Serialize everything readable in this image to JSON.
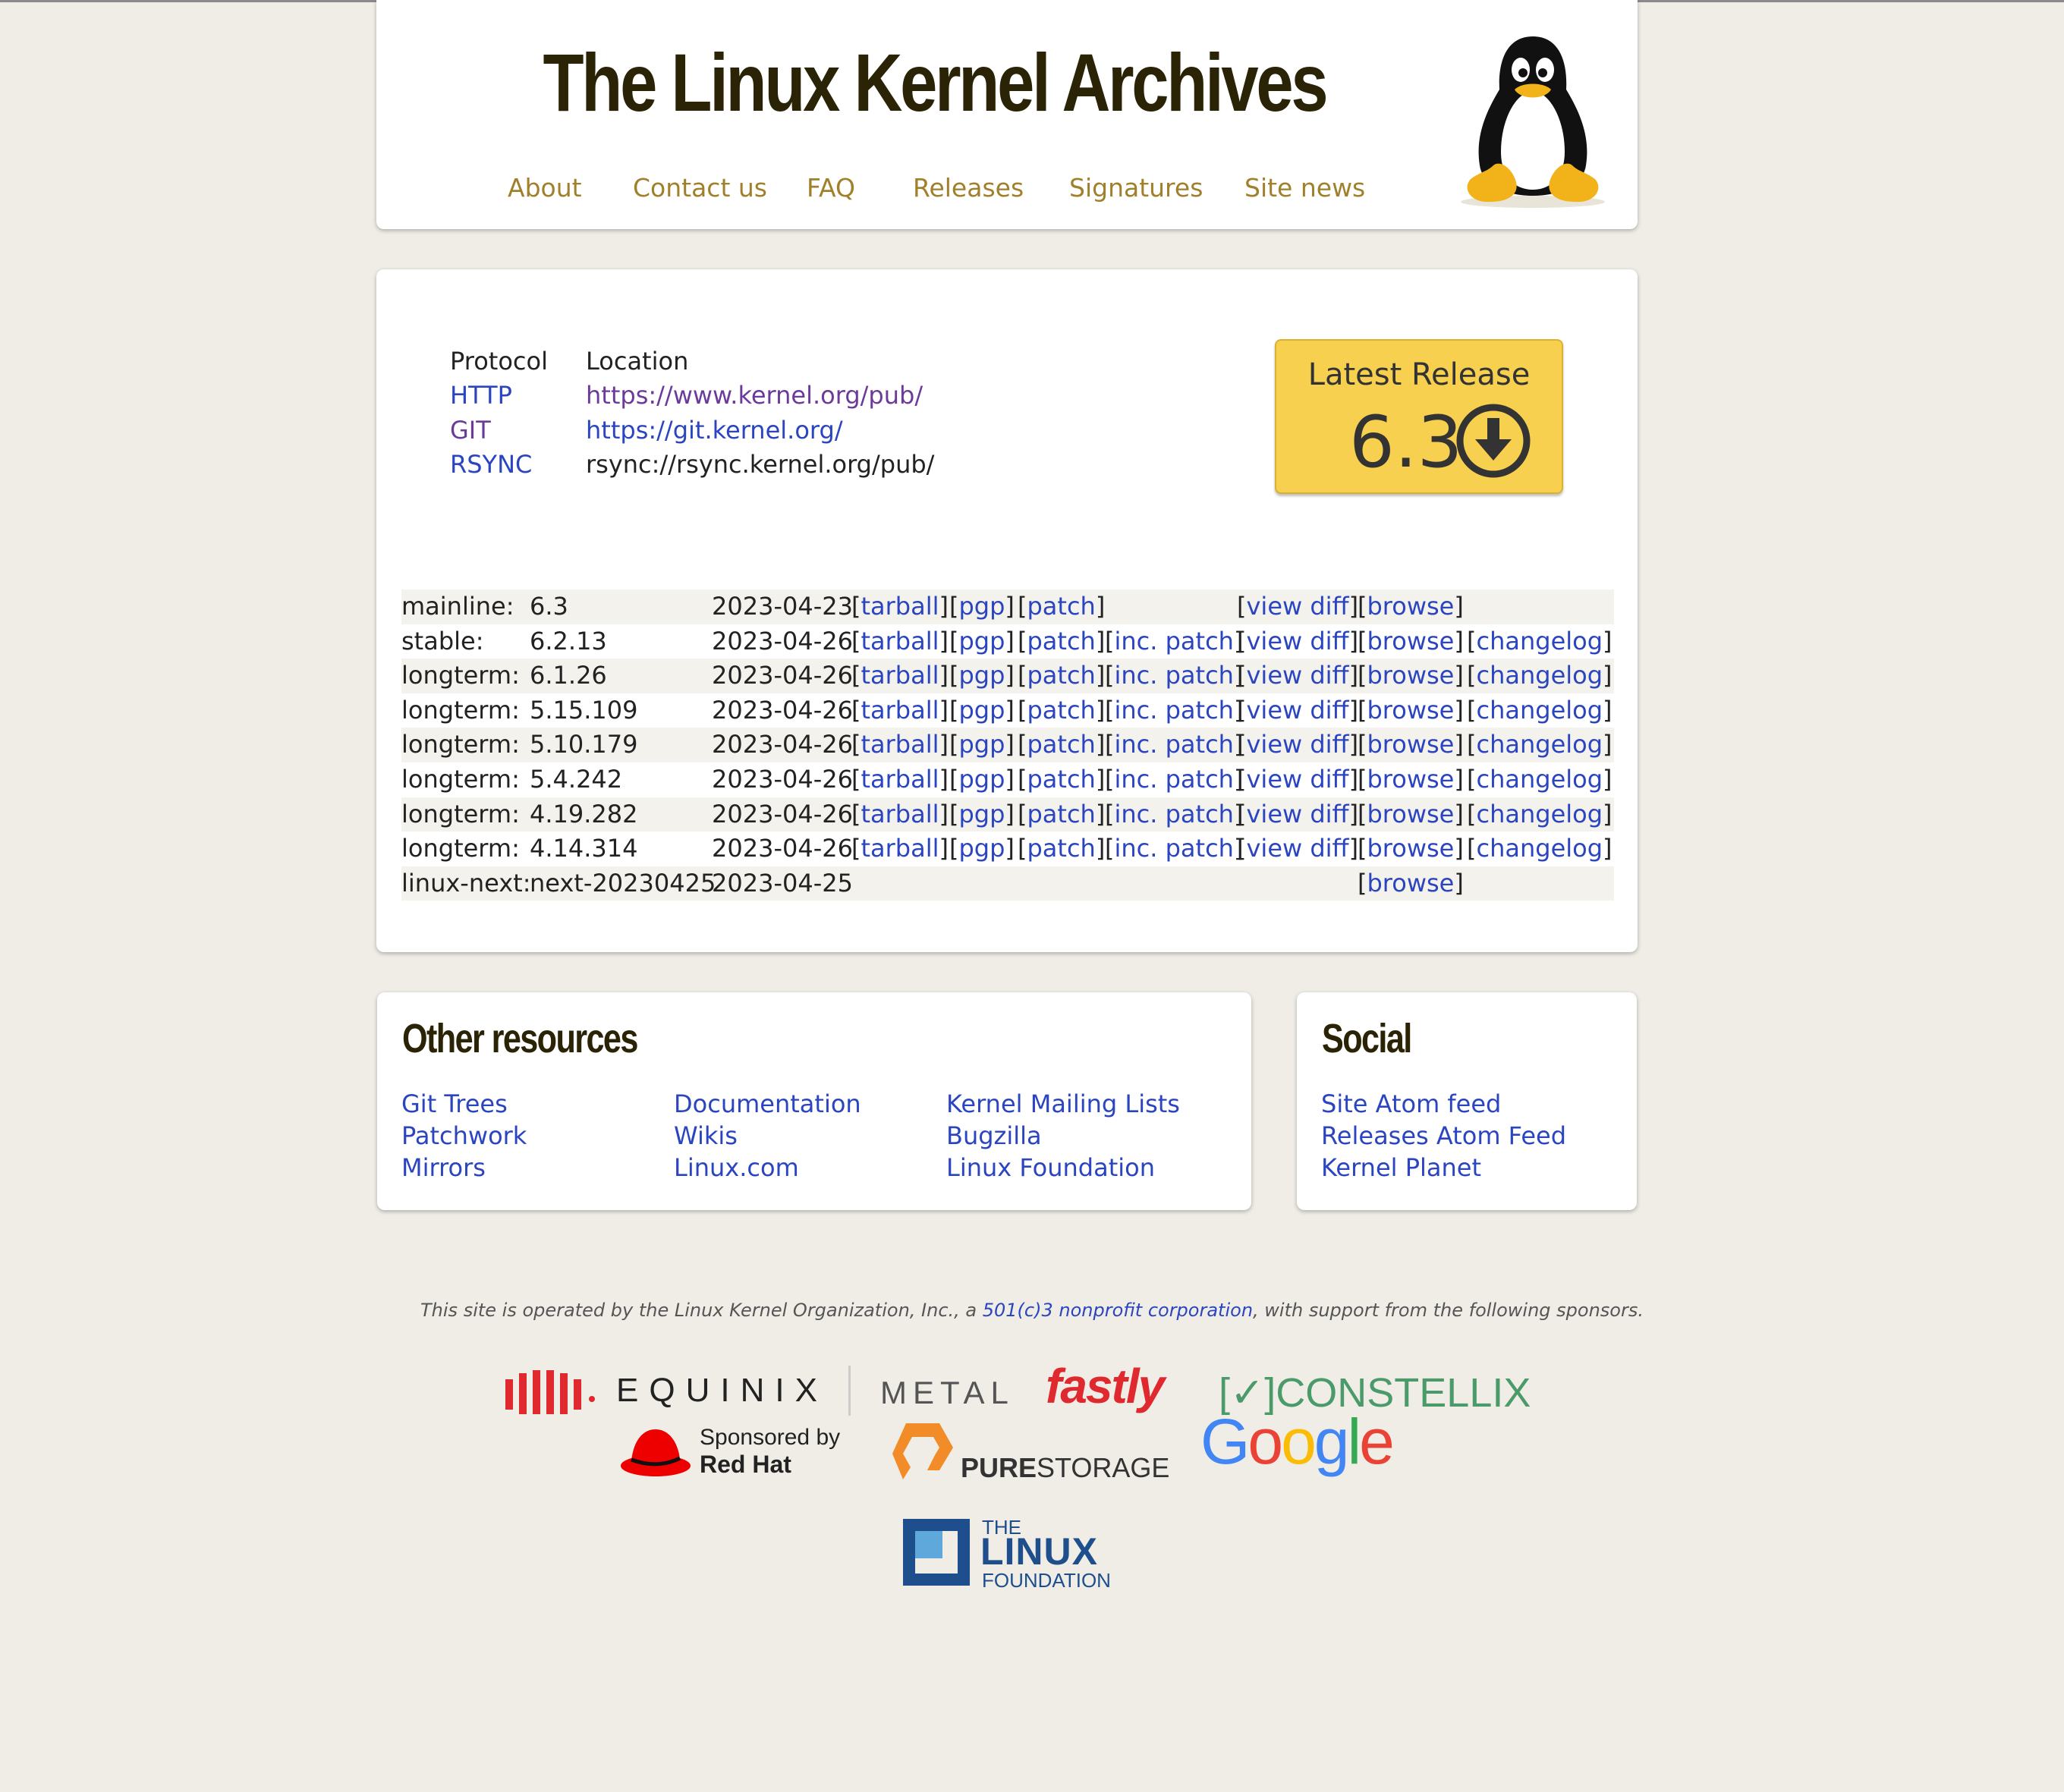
{
  "site": {
    "title": "The Linux Kernel Archives",
    "nav": [
      "About",
      "Contact us",
      "FAQ",
      "Releases",
      "Signatures",
      "Site news"
    ]
  },
  "protocols": {
    "header_protocol": "Protocol",
    "header_location": "Location",
    "rows": [
      {
        "protocol": "HTTP",
        "location": "https://www.kernel.org/pub/"
      },
      {
        "protocol": "GIT",
        "location": "https://git.kernel.org/"
      },
      {
        "protocol": "RSYNC",
        "location": "rsync://rsync.kernel.org/pub/"
      }
    ]
  },
  "latest_release": {
    "label": "Latest Release",
    "version": "6.3",
    "icon": "download-circle-icon",
    "color": "#f6d04e"
  },
  "releases": [
    {
      "branch": "mainline:",
      "version": "6.3",
      "date": "2023-04-23",
      "links": [
        "tarball",
        "pgp",
        "patch",
        "",
        "view diff",
        "browse",
        ""
      ]
    },
    {
      "branch": "stable:",
      "version": "6.2.13",
      "date": "2023-04-26",
      "links": [
        "tarball",
        "pgp",
        "patch",
        "inc. patch",
        "view diff",
        "browse",
        "changelog"
      ]
    },
    {
      "branch": "longterm:",
      "version": "6.1.26",
      "date": "2023-04-26",
      "links": [
        "tarball",
        "pgp",
        "patch",
        "inc. patch",
        "view diff",
        "browse",
        "changelog"
      ]
    },
    {
      "branch": "longterm:",
      "version": "5.15.109",
      "date": "2023-04-26",
      "links": [
        "tarball",
        "pgp",
        "patch",
        "inc. patch",
        "view diff",
        "browse",
        "changelog"
      ]
    },
    {
      "branch": "longterm:",
      "version": "5.10.179",
      "date": "2023-04-26",
      "links": [
        "tarball",
        "pgp",
        "patch",
        "inc. patch",
        "view diff",
        "browse",
        "changelog"
      ]
    },
    {
      "branch": "longterm:",
      "version": "5.4.242",
      "date": "2023-04-26",
      "links": [
        "tarball",
        "pgp",
        "patch",
        "inc. patch",
        "view diff",
        "browse",
        "changelog"
      ]
    },
    {
      "branch": "longterm:",
      "version": "4.19.282",
      "date": "2023-04-26",
      "links": [
        "tarball",
        "pgp",
        "patch",
        "inc. patch",
        "view diff",
        "browse",
        "changelog"
      ]
    },
    {
      "branch": "longterm:",
      "version": "4.14.314",
      "date": "2023-04-26",
      "links": [
        "tarball",
        "pgp",
        "patch",
        "inc. patch",
        "view diff",
        "browse",
        "changelog"
      ]
    },
    {
      "branch": "linux-next:",
      "version": "next-20230425",
      "date": "2023-04-25",
      "links": [
        "",
        "",
        "",
        "",
        "",
        "browse",
        ""
      ]
    }
  ],
  "other_resources": {
    "title": "Other resources",
    "col1": [
      "Git Trees",
      "Patchwork",
      "Mirrors"
    ],
    "col2": [
      "Documentation",
      "Wikis",
      "Linux.com"
    ],
    "col3": [
      "Kernel Mailing Lists",
      "Bugzilla",
      "Linux Foundation"
    ]
  },
  "social": {
    "title": "Social",
    "links": [
      "Site Atom feed",
      "Releases Atom Feed",
      "Kernel Planet"
    ]
  },
  "footer": {
    "text_before": "This site is operated by the Linux Kernel Organization, Inc., a ",
    "link": "501(c)3 nonprofit corporation",
    "text_after": ", with support from the following sponsors."
  },
  "sponsors": {
    "equinix": "EQUINIX",
    "metal": "METAL",
    "fastly": "fastly",
    "constellix_check": "[✓]",
    "constellix": "CONSTELLIX",
    "redhat_sponsored": "Sponsored by",
    "redhat_name": "Red Hat",
    "pure_bold": "PURE",
    "pure_rest": "STORAGE",
    "google": [
      "G",
      "o",
      "o",
      "g",
      "l",
      "e"
    ],
    "lf_the": "THE",
    "lf_linux": "LINUX",
    "lf_foundation": "FOUNDATION"
  },
  "colors": {
    "background": "#efede6",
    "nav_link": "#a0802a",
    "link": "#2b45c0",
    "visited_link": "#6c3b9a",
    "title": "#2a2305"
  }
}
